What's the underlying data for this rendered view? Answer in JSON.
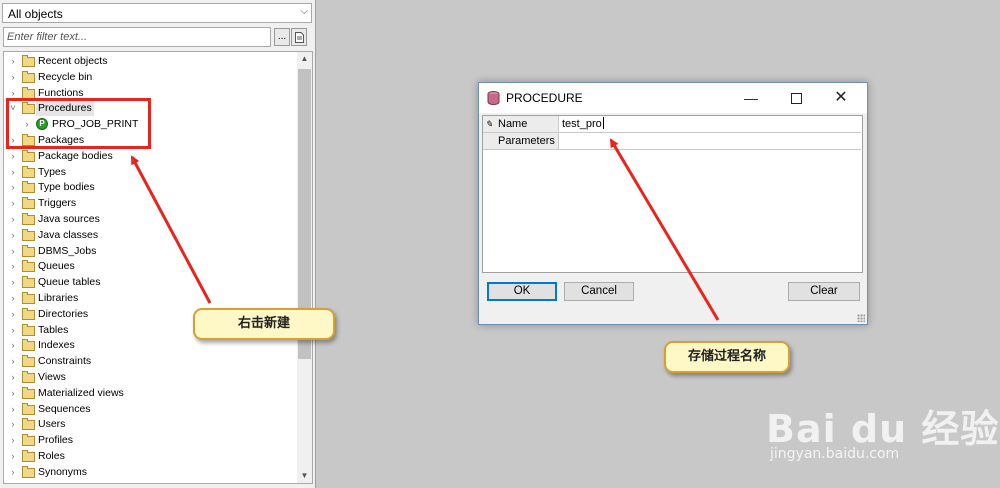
{
  "object_browser": {
    "type_select": "All objects",
    "filter_placeholder": "Enter filter text...",
    "filter_button_label": "...",
    "tree_items": [
      {
        "label": "Recent objects",
        "expanded": false,
        "kind": "folder"
      },
      {
        "label": "Recycle bin",
        "expanded": false,
        "kind": "folder"
      },
      {
        "label": "Functions",
        "expanded": false,
        "kind": "folder"
      },
      {
        "label": "Procedures",
        "expanded": true,
        "kind": "folder",
        "selected": true
      },
      {
        "label": "PRO_JOB_PRINT",
        "expanded": false,
        "kind": "procedure",
        "child": true
      },
      {
        "label": "Packages",
        "expanded": false,
        "kind": "folder"
      },
      {
        "label": "Package bodies",
        "expanded": false,
        "kind": "folder"
      },
      {
        "label": "Types",
        "expanded": false,
        "kind": "folder"
      },
      {
        "label": "Type bodies",
        "expanded": false,
        "kind": "folder"
      },
      {
        "label": "Triggers",
        "expanded": false,
        "kind": "folder"
      },
      {
        "label": "Java sources",
        "expanded": false,
        "kind": "folder"
      },
      {
        "label": "Java classes",
        "expanded": false,
        "kind": "folder"
      },
      {
        "label": "DBMS_Jobs",
        "expanded": false,
        "kind": "folder"
      },
      {
        "label": "Queues",
        "expanded": false,
        "kind": "folder"
      },
      {
        "label": "Queue tables",
        "expanded": false,
        "kind": "folder"
      },
      {
        "label": "Libraries",
        "expanded": false,
        "kind": "folder"
      },
      {
        "label": "Directories",
        "expanded": false,
        "kind": "folder"
      },
      {
        "label": "Tables",
        "expanded": false,
        "kind": "folder"
      },
      {
        "label": "Indexes",
        "expanded": false,
        "kind": "folder"
      },
      {
        "label": "Constraints",
        "expanded": false,
        "kind": "folder"
      },
      {
        "label": "Views",
        "expanded": false,
        "kind": "folder"
      },
      {
        "label": "Materialized views",
        "expanded": false,
        "kind": "folder"
      },
      {
        "label": "Sequences",
        "expanded": false,
        "kind": "folder"
      },
      {
        "label": "Users",
        "expanded": false,
        "kind": "folder"
      },
      {
        "label": "Profiles",
        "expanded": false,
        "kind": "folder"
      },
      {
        "label": "Roles",
        "expanded": false,
        "kind": "folder"
      },
      {
        "label": "Synonyms",
        "expanded": false,
        "kind": "folder"
      }
    ]
  },
  "dialog": {
    "title": "PROCEDURE",
    "fields": [
      {
        "key": "Name",
        "value": "test_pro",
        "editing": true
      },
      {
        "key": "Parameters",
        "value": ""
      }
    ],
    "ok_label": "OK",
    "cancel_label": "Cancel",
    "clear_label": "Clear"
  },
  "annotations": {
    "callout_left": "右击新建",
    "callout_right": "存储过程名称"
  },
  "watermark": {
    "logo": "Bai du 经验",
    "url": "jingyan.baidu.com"
  },
  "colors": {
    "annotation_red": "#e8241c",
    "callout_bg": "#fdf8c5",
    "folder": "#f1d883",
    "procedure_icon": "#2e9b2e"
  }
}
